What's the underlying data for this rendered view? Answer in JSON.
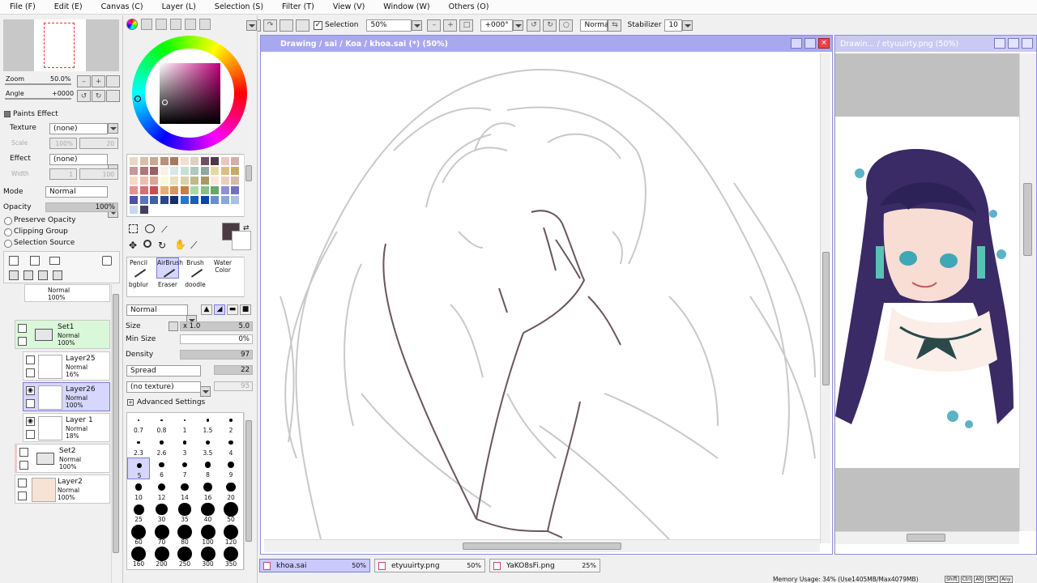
{
  "menu": [
    "File (F)",
    "Edit (E)",
    "Canvas (C)",
    "Layer (L)",
    "Selection (S)",
    "Filter (T)",
    "View (V)",
    "Window (W)",
    "Others (O)"
  ],
  "toolbar": {
    "selection_label": "Selection",
    "zoom": "50%",
    "angle": "+000°",
    "blend": "Normal",
    "stabilizer_label": "Stabilizer",
    "stabilizer": "10"
  },
  "nav": {
    "zoom_label": "Zoom",
    "zoom_value": "50.0%",
    "angle_label": "Angle",
    "angle_value": "+0000"
  },
  "paints": {
    "header": "Paints Effect",
    "texture_label": "Texture",
    "texture_value": "(none)",
    "scale_label": "Scale",
    "scale_value": "100%",
    "scale_num": "20",
    "effect_label": "Effect",
    "effect_value": "(none)",
    "width_label": "Width",
    "width_value": "1",
    "width_num": "100"
  },
  "layerprops": {
    "mode_label": "Mode",
    "mode_value": "Normal",
    "opacity_label": "Opacity",
    "opacity_value": "100%",
    "preserve": "Preserve Opacity",
    "clipping": "Clipping Group",
    "selection_source": "Selection Source"
  },
  "layers": [
    {
      "name": "",
      "mode": "Normal",
      "opacity": "100%"
    },
    {
      "name": "Set1",
      "mode": "Normal",
      "opacity": "100%"
    },
    {
      "name": "Layer25",
      "mode": "Normal",
      "opacity": "16%"
    },
    {
      "name": "Layer26",
      "mode": "Normal",
      "opacity": "100%"
    },
    {
      "name": "Layer 1",
      "mode": "Normal",
      "opacity": "18%"
    },
    {
      "name": "Set2",
      "mode": "Normal",
      "opacity": "100%"
    },
    {
      "name": "Layer2",
      "mode": "Normal",
      "opacity": "100%"
    }
  ],
  "tools": {
    "r1": [
      "Pencil",
      "AirBrush",
      "Brush",
      "Water Color"
    ],
    "r2": [
      "bgblur",
      "Eraser",
      "doodle"
    ]
  },
  "brush": {
    "blend": "Normal",
    "size_label": "Size",
    "size_mult": "x 1.0",
    "size_value": "5.0",
    "minsize_label": "Min Size",
    "minsize_value": "0%",
    "density_label": "Density",
    "density_value": "97",
    "spread": "Spread",
    "spread_value": "22",
    "texture": "(no texture)",
    "texture_value": "95",
    "advanced": "Advanced Settings"
  },
  "sizes": [
    [
      "0.7",
      "0.8",
      "1",
      "1.5",
      "2"
    ],
    [
      "2.3",
      "2.6",
      "3",
      "3.5",
      "4"
    ],
    [
      "5",
      "6",
      "7",
      "8",
      "9"
    ],
    [
      "10",
      "12",
      "14",
      "16",
      "20"
    ],
    [
      "25",
      "30",
      "35",
      "40",
      "50"
    ],
    [
      "60",
      "70",
      "80",
      "100",
      "120"
    ],
    [
      "160",
      "200",
      "250",
      "300",
      "350"
    ]
  ],
  "canvas": {
    "title": "Drawing / sai / Koa / khoa.sai (*) (50%)"
  },
  "ref": {
    "title": "Drawin... / etyuuirty.png (50%)"
  },
  "tabs": [
    {
      "name": "khoa.sai",
      "pct": "50%"
    },
    {
      "name": "etyuuirty.png",
      "pct": "50%"
    },
    {
      "name": "YaKO8sFi.png",
      "pct": "25%"
    }
  ],
  "status": {
    "memory": "Memory Usage: 34% (Use1405MB/Max4079MB)",
    "keys": [
      "Shift",
      "Ctrl",
      "Alt",
      "SPC",
      "Any"
    ]
  },
  "colors": {
    "accent": "#a8a8ef",
    "selected_layer": "#d6d6ff",
    "set_layer": "#d9f7d9",
    "current_color": "#4a3a42"
  }
}
